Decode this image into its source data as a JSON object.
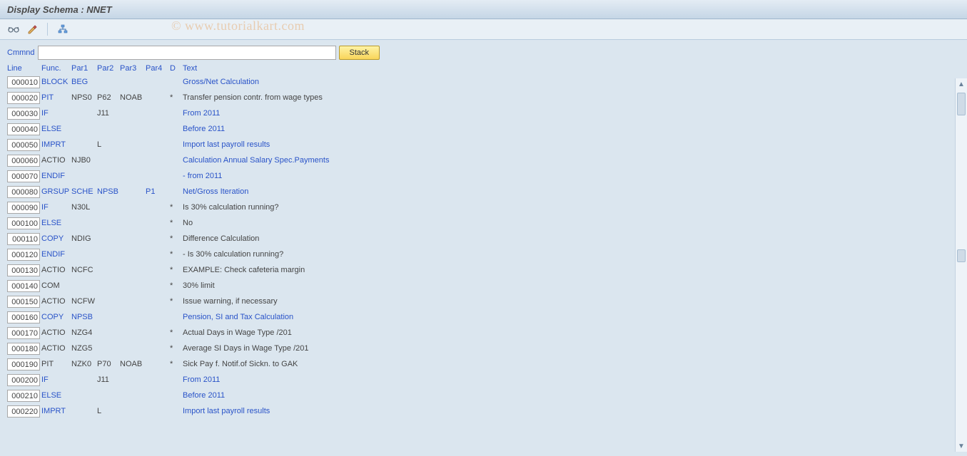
{
  "title": "Display Schema : NNET",
  "watermark": "© www.tutorialkart.com",
  "cmd_label": "Cmmnd",
  "stack_label": "Stack",
  "headers": {
    "line": "Line",
    "func": "Func.",
    "par1": "Par1",
    "par2": "Par2",
    "par3": "Par3",
    "par4": "Par4",
    "d": "D",
    "text": "Text"
  },
  "rows": [
    {
      "line": "000010",
      "func": "BLOCK",
      "par1": "BEG",
      "par2": "",
      "par3": "",
      "par4": "",
      "d": "",
      "text": "Gross/Net Calculation",
      "link_func": true,
      "link_par1": true,
      "link_text": true
    },
    {
      "line": "000020",
      "func": "PIT",
      "par1": "NPS0",
      "par2": "P62",
      "par3": "NOAB",
      "par4": "",
      "d": "*",
      "text": "Transfer pension contr. from wage types",
      "link_func": true
    },
    {
      "line": "000030",
      "func": "IF",
      "par1": "",
      "par2": "J11",
      "par3": "",
      "par4": "",
      "d": "",
      "text": "From 2011",
      "link_func": true,
      "link_text": true
    },
    {
      "line": "000040",
      "func": "ELSE",
      "par1": "",
      "par2": "",
      "par3": "",
      "par4": "",
      "d": "",
      "text": "Before 2011",
      "link_func": true,
      "link_text": true
    },
    {
      "line": "000050",
      "func": "IMPRT",
      "par1": "",
      "par2": "L",
      "par3": "",
      "par4": "",
      "d": "",
      "text": "Import last payroll results",
      "link_func": true,
      "link_text": true
    },
    {
      "line": "000060",
      "func": "ACTIO",
      "par1": "NJB0",
      "par2": "",
      "par3": "",
      "par4": "",
      "d": "",
      "text": "Calculation Annual Salary Spec.Payments",
      "link_text": true
    },
    {
      "line": "000070",
      "func": "ENDIF",
      "par1": "",
      "par2": "",
      "par3": "",
      "par4": "",
      "d": "",
      "text": "- from 2011",
      "link_func": true,
      "link_text": true
    },
    {
      "line": "000080",
      "func": "GRSUP",
      "par1": "SCHE",
      "par2": "NPSB",
      "par3": "",
      "par4": "P1",
      "d": "",
      "text": "Net/Gross Iteration",
      "link_func": true,
      "link_par1": true,
      "link_par2": true,
      "link_par4": true,
      "link_text": true
    },
    {
      "line": "000090",
      "func": "IF",
      "par1": "N30L",
      "par2": "",
      "par3": "",
      "par4": "",
      "d": "*",
      "text": "Is 30% calculation running?",
      "link_func": true
    },
    {
      "line": "000100",
      "func": "ELSE",
      "par1": "",
      "par2": "",
      "par3": "",
      "par4": "",
      "d": "*",
      "text": "No",
      "link_func": true
    },
    {
      "line": "000110",
      "func": "COPY",
      "par1": "NDIG",
      "par2": "",
      "par3": "",
      "par4": "",
      "d": "*",
      "text": "Difference Calculation",
      "link_func": true
    },
    {
      "line": "000120",
      "func": "ENDIF",
      "par1": "",
      "par2": "",
      "par3": "",
      "par4": "",
      "d": "*",
      "text": "- Is 30% calculation running?",
      "link_func": true
    },
    {
      "line": "000130",
      "func": "ACTIO",
      "par1": "NCFC",
      "par2": "",
      "par3": "",
      "par4": "",
      "d": "*",
      "text": "EXAMPLE: Check cafeteria margin"
    },
    {
      "line": "000140",
      "func": "COM",
      "par1": "",
      "par2": "",
      "par3": "",
      "par4": "",
      "d": "*",
      "text": "30% limit"
    },
    {
      "line": "000150",
      "func": "ACTIO",
      "par1": "NCFW",
      "par2": "",
      "par3": "",
      "par4": "",
      "d": "*",
      "text": "Issue warning, if necessary"
    },
    {
      "line": "000160",
      "func": "COPY",
      "par1": "NPSB",
      "par2": "",
      "par3": "",
      "par4": "",
      "d": "",
      "text": "Pension, SI and Tax Calculation",
      "link_func": true,
      "link_par1": true,
      "link_text": true
    },
    {
      "line": "000170",
      "func": "ACTIO",
      "par1": "NZG4",
      "par2": "",
      "par3": "",
      "par4": "",
      "d": "*",
      "text": "Actual Days in Wage Type /201"
    },
    {
      "line": "000180",
      "func": "ACTIO",
      "par1": "NZG5",
      "par2": "",
      "par3": "",
      "par4": "",
      "d": "*",
      "text": "Average SI Days in Wage Type /201"
    },
    {
      "line": "000190",
      "func": "PIT",
      "par1": "NZK0",
      "par2": "P70",
      "par3": "NOAB",
      "par4": "",
      "d": "*",
      "text": "Sick Pay f. Notif.of Sickn. to GAK"
    },
    {
      "line": "000200",
      "func": "IF",
      "par1": "",
      "par2": "J11",
      "par3": "",
      "par4": "",
      "d": "",
      "text": "From 2011",
      "link_func": true,
      "link_text": true
    },
    {
      "line": "000210",
      "func": "ELSE",
      "par1": "",
      "par2": "",
      "par3": "",
      "par4": "",
      "d": "",
      "text": "Before 2011",
      "link_func": true,
      "link_text": true
    },
    {
      "line": "000220",
      "func": "IMPRT",
      "par1": "",
      "par2": "L",
      "par3": "",
      "par4": "",
      "d": "",
      "text": "Import last payroll results",
      "link_func": true,
      "link_text": true
    }
  ]
}
